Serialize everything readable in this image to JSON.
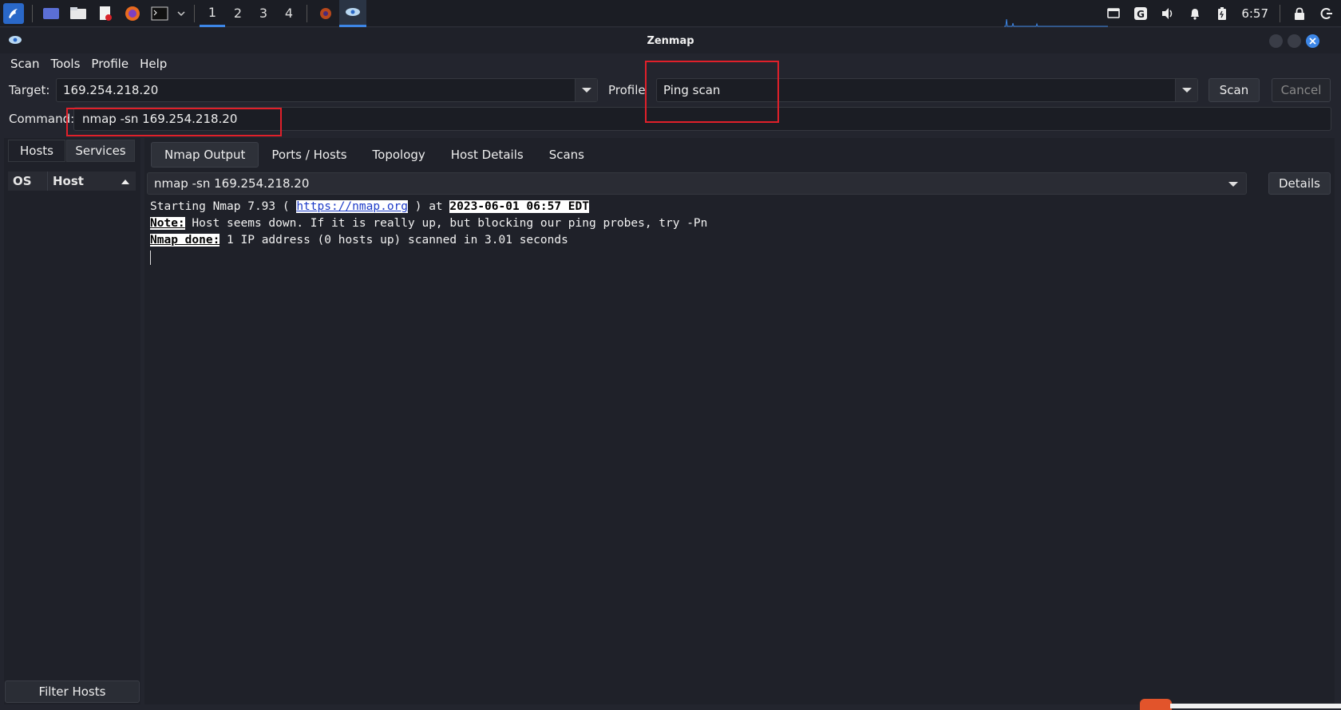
{
  "taskbar": {
    "workspaces": [
      "1",
      "2",
      "3",
      "4"
    ],
    "active_workspace": "1",
    "clock": "6:57"
  },
  "window": {
    "title": "Zenmap"
  },
  "menubar": {
    "items": [
      "Scan",
      "Tools",
      "Profile",
      "Help"
    ]
  },
  "toolbar": {
    "target_label": "Target:",
    "target_value": "169.254.218.20",
    "profile_label": "Profile",
    "profile_value": "Ping scan",
    "scan_label": "Scan",
    "cancel_label": "Cancel",
    "command_label": "Command:",
    "command_value": "nmap -sn 169.254.218.20"
  },
  "left_panel": {
    "hosts_tab": "Hosts",
    "services_tab": "Services",
    "col_os": "OS",
    "col_host": "Host",
    "filter_label": "Filter Hosts"
  },
  "right_panel": {
    "tabs": [
      "Nmap Output",
      "Ports / Hosts",
      "Topology",
      "Host Details",
      "Scans"
    ],
    "active_tab": "Nmap Output",
    "scan_select_value": "nmap -sn 169.254.218.20",
    "details_label": "Details",
    "output": {
      "line1_prefix": "Starting Nmap 7.93 ( ",
      "line1_link": "https://nmap.org",
      "line1_mid": " ) at ",
      "line1_date": "2023-06-01 06:57 EDT",
      "line2_key": "Note:",
      "line2_text": " Host seems down. If it is really up, but blocking our ping probes, try -Pn",
      "line3_key": "Nmap done:",
      "line3_text": " 1 IP address (0 hosts up) scanned in 3.01 seconds"
    }
  },
  "colors": {
    "accent": "#3d86e6",
    "highlight_box": "#e0202a",
    "background": "#23252e"
  }
}
